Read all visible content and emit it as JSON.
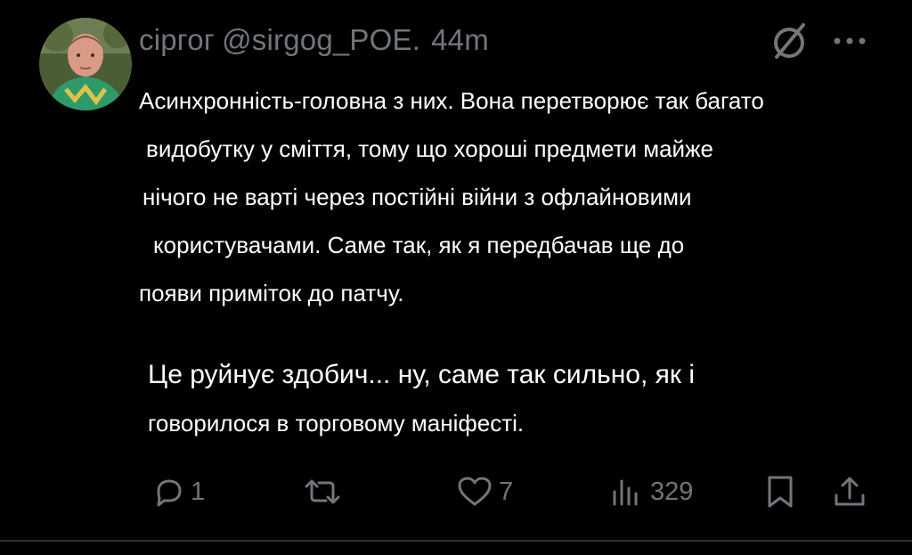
{
  "post": {
    "display_name": "сіргог",
    "handle": "@sirgog_POE.",
    "time": "44m",
    "text_lines": [
      "Асинхронність-головна з них. Вона перетворює так багато",
      "видобутку у сміття, тому що хороші предмети майже",
      "нічого не варті через постійні війни з офлайновими",
      "користувачами. Саме так, як я передбачав ще до",
      "появи приміток до патчу."
    ],
    "text_lines_2": [
      "Це руйнує здобич... ну, саме так сильно, як і",
      "говорилося в торговому маніфесті."
    ]
  },
  "actions": {
    "reply": {
      "icon": "reply-icon",
      "count": "1"
    },
    "repost": {
      "icon": "repost-icon",
      "count": ""
    },
    "like": {
      "icon": "heart-icon",
      "count": "7"
    },
    "views": {
      "icon": "views-icon",
      "count": "329"
    },
    "bookmark": {
      "icon": "bookmark-icon"
    },
    "share": {
      "icon": "share-icon"
    }
  },
  "colors": {
    "background": "#000000",
    "text": "#ffffff",
    "muted": "#71767b",
    "divider": "#2f3336"
  }
}
